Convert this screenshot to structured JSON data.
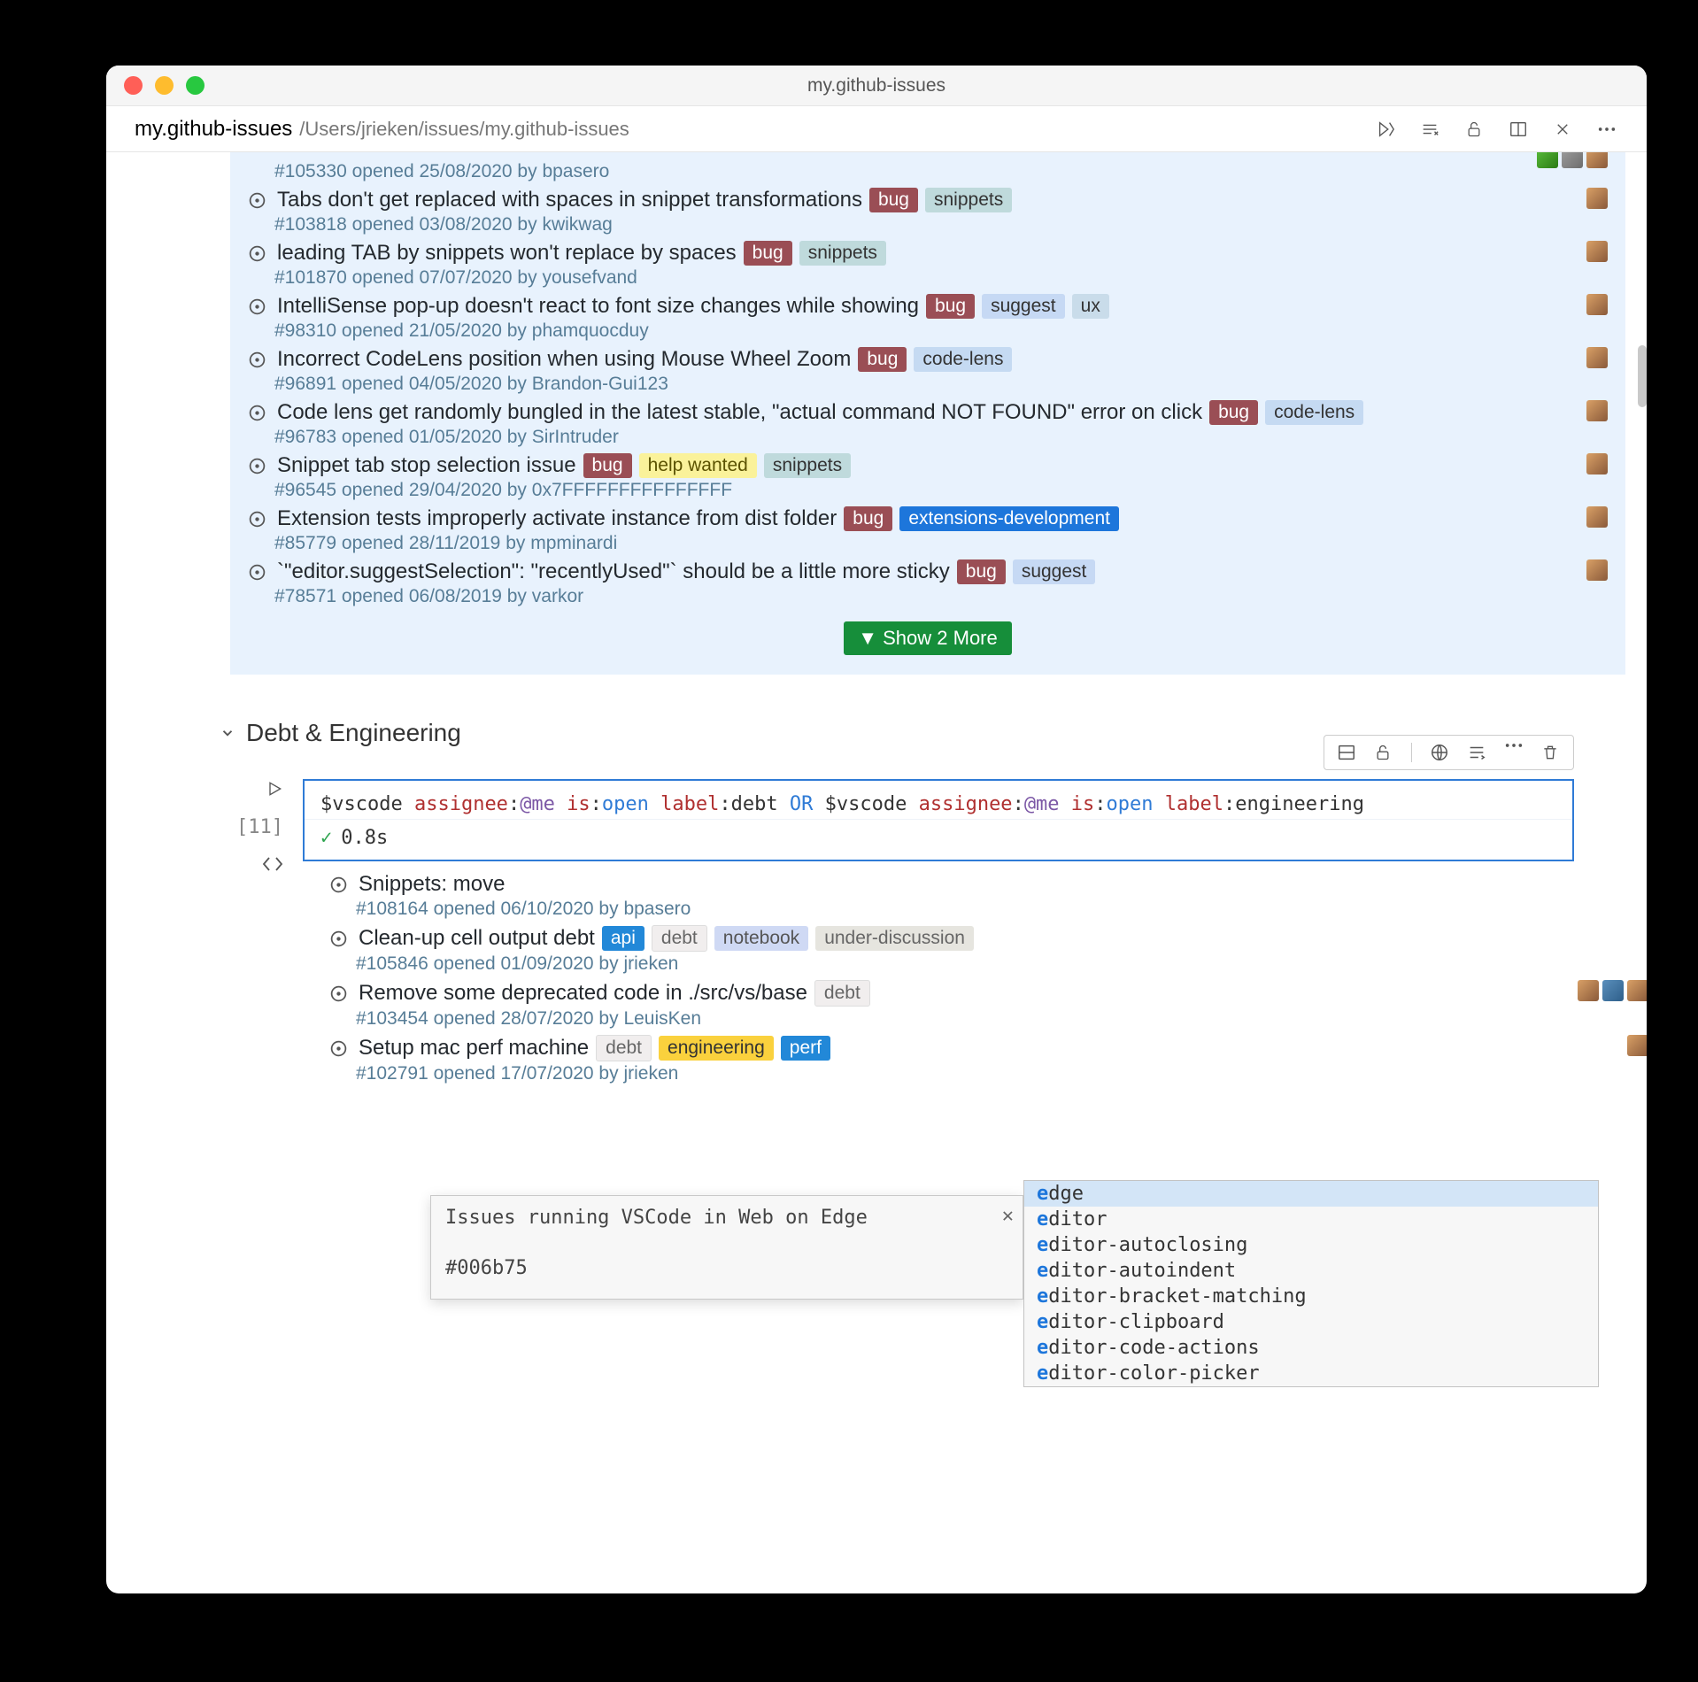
{
  "window": {
    "title": "my.github-issues",
    "tab_title": "my.github-issues",
    "path": "/Users/jrieken/issues/my.github-issues"
  },
  "issues_panel1": [
    {
      "id": "#105330",
      "date": "25/08/2020",
      "author": "bpasero",
      "title": "",
      "labels": []
    },
    {
      "id": "#103818",
      "date": "03/08/2020",
      "author": "kwikwag",
      "title": "Tabs don't get replaced with spaces in snippet transformations",
      "labels": [
        [
          "bug",
          "lbl-bug"
        ],
        [
          "snippets",
          "lbl-snippets"
        ]
      ]
    },
    {
      "id": "#101870",
      "date": "07/07/2020",
      "author": "yousefvand",
      "title": "leading TAB by snippets won't replace by spaces",
      "labels": [
        [
          "bug",
          "lbl-bug"
        ],
        [
          "snippets",
          "lbl-snippets"
        ]
      ]
    },
    {
      "id": "#98310",
      "date": "21/05/2020",
      "author": "phamquocduy",
      "title": "IntelliSense pop-up doesn't react to font size changes while showing",
      "labels": [
        [
          "bug",
          "lbl-bug"
        ],
        [
          "suggest",
          "lbl-suggest"
        ],
        [
          "ux",
          "lbl-ux"
        ]
      ]
    },
    {
      "id": "#96891",
      "date": "04/05/2020",
      "author": "Brandon-Gui123",
      "title": "Incorrect CodeLens position when using Mouse Wheel Zoom",
      "labels": [
        [
          "bug",
          "lbl-bug"
        ],
        [
          "code-lens",
          "lbl-codelens"
        ]
      ]
    },
    {
      "id": "#96783",
      "date": "01/05/2020",
      "author": "SirIntruder",
      "title": "Code lens get randomly bungled in the latest stable, \"actual command NOT FOUND\" error on click",
      "labels": [
        [
          "bug",
          "lbl-bug"
        ],
        [
          "code-lens",
          "lbl-codelens"
        ]
      ]
    },
    {
      "id": "#96545",
      "date": "29/04/2020",
      "author": "0x7FFFFFFFFFFFFFFF",
      "title": "Snippet tab stop selection issue",
      "labels": [
        [
          "bug",
          "lbl-bug"
        ],
        [
          "help wanted",
          "lbl-help"
        ],
        [
          "snippets",
          "lbl-snippets"
        ]
      ]
    },
    {
      "id": "#85779",
      "date": "28/11/2019",
      "author": "mpminardi",
      "title": "Extension tests improperly activate instance from dist folder",
      "labels": [
        [
          "bug",
          "lbl-bug"
        ],
        [
          "extensions-development",
          "lbl-ext"
        ]
      ]
    },
    {
      "id": "#78571",
      "date": "06/08/2019",
      "author": "varkor",
      "title": "`\"editor.suggestSelection\": \"recentlyUsed\"` should be a little more sticky",
      "labels": [
        [
          "bug",
          "lbl-bug"
        ],
        [
          "suggest",
          "lbl-suggest"
        ]
      ]
    }
  ],
  "show_more": "▼ Show 2 More",
  "section2_title": "Debt & Engineering",
  "query": {
    "parts": [
      "$vscode ",
      "assignee",
      ":",
      "@me ",
      "is",
      ":",
      "open ",
      "label",
      ":",
      "debt  ",
      "OR",
      "  $vscode ",
      "assignee",
      ":",
      "@me ",
      "is",
      ":",
      "open ",
      "label",
      ":",
      "engineering"
    ],
    "status_time": "0.8s"
  },
  "gutter": {
    "count": "[11]"
  },
  "hover": {
    "line1": "Issues running VSCode in Web on Edge",
    "line2": "#006b75"
  },
  "suggest": [
    "edge",
    "editor",
    "editor-autoclosing",
    "editor-autoindent",
    "editor-bracket-matching",
    "editor-clipboard",
    "editor-code-actions",
    "editor-color-picker"
  ],
  "issues_panel2": [
    {
      "id": "#108164",
      "date": "06/10/2020",
      "author": "bpasero",
      "title": "Snippets: move",
      "labels": []
    },
    {
      "id": "#105846",
      "date": "01/09/2020",
      "author": "jrieken",
      "title": "Clean-up cell output debt",
      "labels": [
        [
          "api",
          "lbl-api"
        ],
        [
          "debt",
          "lbl-debt"
        ],
        [
          "notebook",
          "lbl-notebook"
        ],
        [
          "under-discussion",
          "lbl-under"
        ]
      ]
    },
    {
      "id": "#103454",
      "date": "28/07/2020",
      "author": "LeuisKen",
      "title": "Remove some deprecated code in ./src/vs/base",
      "labels": [
        [
          "debt",
          "lbl-debt"
        ]
      ],
      "multi_avatar": true
    },
    {
      "id": "#102791",
      "date": "17/07/2020",
      "author": "jrieken",
      "title": "Setup mac perf machine",
      "labels": [
        [
          "debt",
          "lbl-debt"
        ],
        [
          "engineering",
          "lbl-eng"
        ],
        [
          "perf",
          "lbl-perf"
        ]
      ]
    }
  ],
  "meta_words": {
    "opened": "opened",
    "by": "by"
  }
}
